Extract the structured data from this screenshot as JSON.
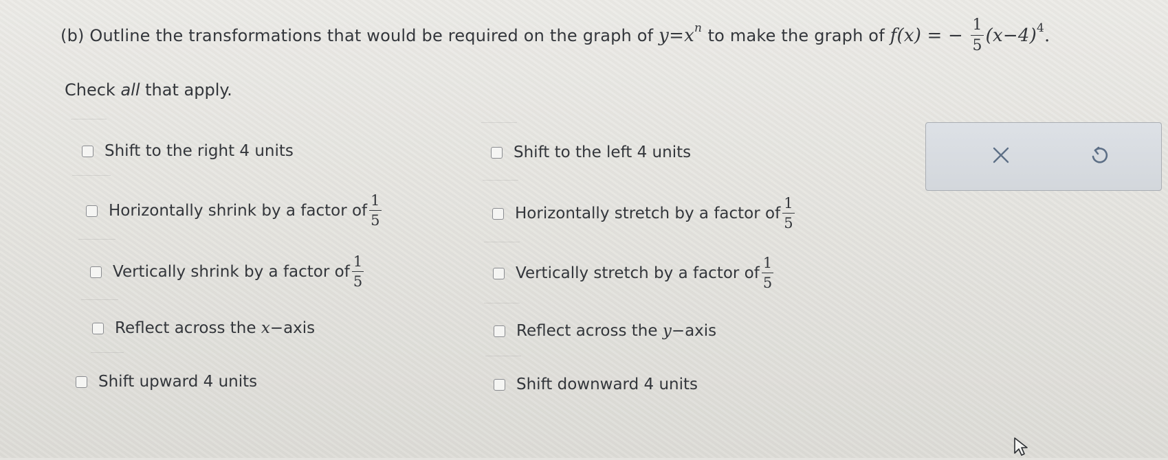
{
  "question": {
    "label": "(b) Outline the transformations that would be required on the graph of",
    "parent_y": "y",
    "equals": "=",
    "parent_x": "x",
    "parent_exp": "n",
    "connector": "to make the graph of",
    "f_name": "f",
    "f_arg": "(x)",
    "f_equals": "= −",
    "frac_num": "1",
    "frac_den": "5",
    "f_body": "(x−4)",
    "f_exp": "4",
    "period": "."
  },
  "instruction": {
    "prefix": "Check ",
    "emphasis": "all",
    "suffix": " that apply."
  },
  "options": [
    {
      "id": "shift-right-4",
      "text": "Shift to the right 4 units",
      "checked": false
    },
    {
      "id": "shift-left-4",
      "text": "Shift to the left 4 units",
      "checked": false
    },
    {
      "id": "h-shrink",
      "text": "Horizontally shrink by a factor of",
      "frac_num": "1",
      "frac_den": "5",
      "checked": false
    },
    {
      "id": "h-stretch",
      "text": "Horizontally stretch by a factor of",
      "frac_num": "1",
      "frac_den": "5",
      "checked": false
    },
    {
      "id": "v-shrink",
      "text": "Vertically shrink by a factor of",
      "frac_num": "1",
      "frac_den": "5",
      "checked": false
    },
    {
      "id": "v-stretch",
      "text": "Vertically stretch by a factor of",
      "frac_num": "1",
      "frac_den": "5",
      "checked": false
    },
    {
      "id": "reflect-x",
      "text_before": "Reflect across the ",
      "var": "x",
      "text_after": "−axis",
      "checked": false
    },
    {
      "id": "reflect-y",
      "text_before": "Reflect across the ",
      "var": "y",
      "text_after": "−axis",
      "checked": false
    },
    {
      "id": "shift-up-4",
      "text": "Shift upward 4 units",
      "checked": false
    },
    {
      "id": "shift-down-4",
      "text": "Shift downward 4 units",
      "checked": false
    }
  ],
  "tools": {
    "clear_icon": "close-icon",
    "undo_icon": "undo-icon"
  },
  "colors": {
    "text": "#33363b",
    "panel_bg": "#d8dce1",
    "panel_border": "#a9adb3",
    "icon": "#5d6f86"
  }
}
